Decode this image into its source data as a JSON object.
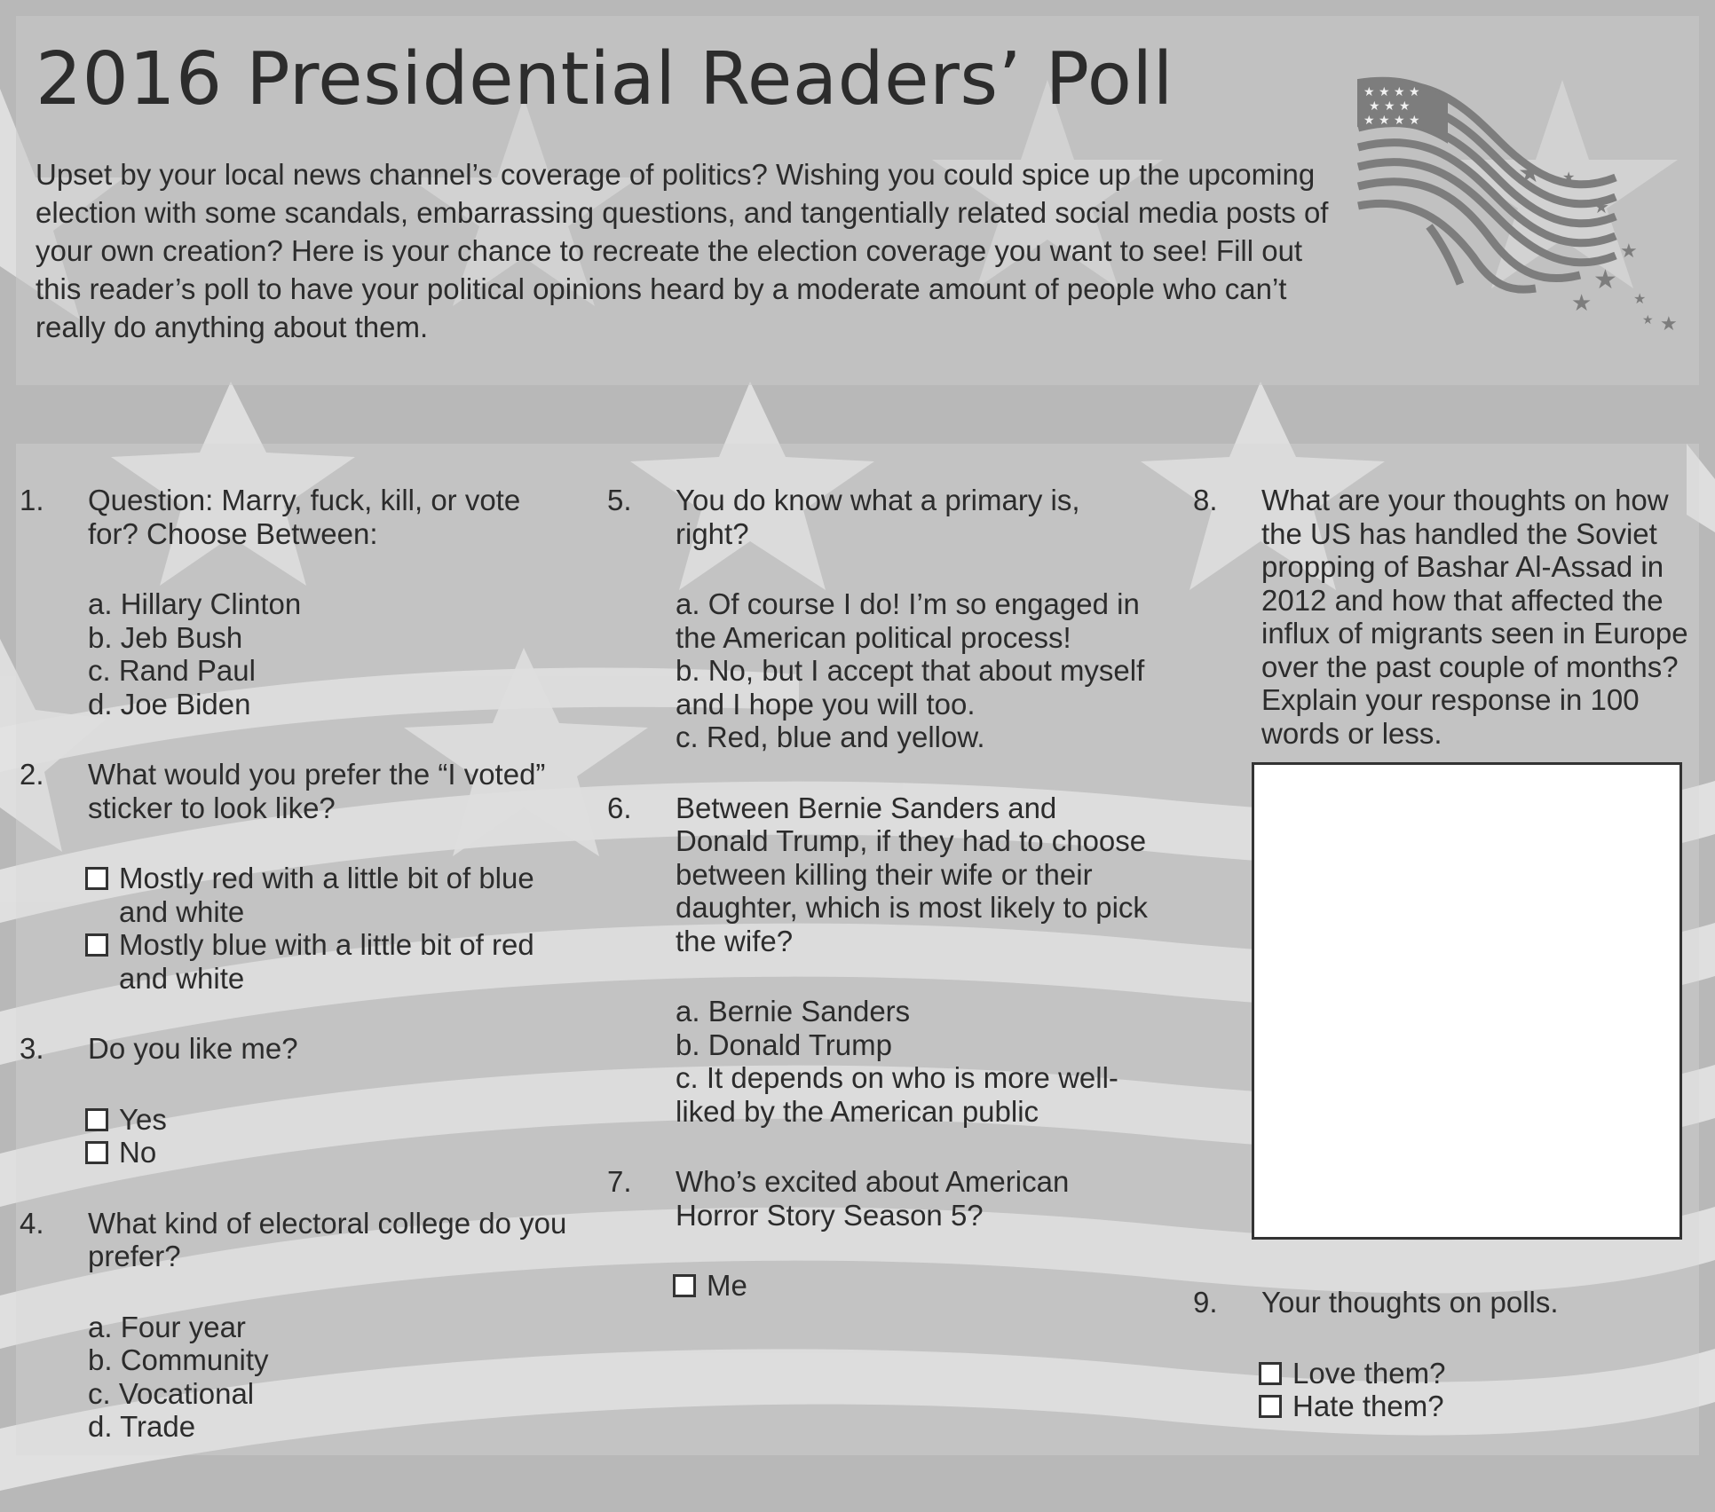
{
  "header": {
    "title": "2016 Presidential Readers’ Poll",
    "intro": "Upset by your local news channel’s coverage of politics? Wishing you could spice up the upcoming election with some scandals, embarrassing questions, and tangentially related social media posts of your own creation? Here is your chance to recreate the election coverage you want to see! Fill out this reader’s poll to have your political opinions heard by a moderate amount of people who can’t really do anything about them."
  },
  "questions": [
    {
      "num": "1.",
      "text": "Question: Marry, fuck, kill, or vote for? Choose Between:",
      "options": [
        "a. Hillary Clinton",
        "b. Jeb Bush",
        "c. Rand Paul",
        "d. Joe Biden"
      ]
    },
    {
      "num": "2.",
      "text": "What would you prefer the “I voted” sticker to look like?",
      "checkboxes": [
        "Mostly red with a little bit of blue and white",
        "Mostly blue with a little bit of red and white"
      ]
    },
    {
      "num": "3.",
      "text": "Do you like me?",
      "checkboxes": [
        "Yes",
        "No"
      ]
    },
    {
      "num": "4.",
      "text": "What kind of electoral college do you prefer?",
      "options": [
        "a. Four year",
        "b. Community",
        "c. Vocational",
        "d. Trade"
      ]
    },
    {
      "num": "5.",
      "text": "You do know what a primary is, right?",
      "options": [
        "a. Of course I do! I’m so engaged in the American political process!",
        "b. No, but I accept that about myself and I hope you will too.",
        "c. Red, blue and yellow."
      ]
    },
    {
      "num": "6.",
      "text": "Between Bernie Sanders and Donald Trump, if they had to choose between killing their wife or their daughter, which is most likely to pick the wife?",
      "options": [
        "a. Bernie Sanders",
        "b. Donald Trump",
        "c. It depends on who is more well-liked by the American public"
      ]
    },
    {
      "num": "7.",
      "text": "Who’s excited about American Horror Story Season 5?",
      "checkboxes": [
        "Me"
      ]
    },
    {
      "num": "8.",
      "text": "What are your thoughts on how the US has handled the Soviet propping of Bashar Al-Assad in 2012 and how that affected the influx of migrants seen in Europe over the past couple of months? Explain your response in 100 words or less."
    },
    {
      "num": "9.",
      "text": "Your thoughts on polls.",
      "checkboxes": [
        "Love them?",
        "Hate them?"
      ]
    }
  ],
  "icons": {
    "flag": "american-flag-icon"
  }
}
